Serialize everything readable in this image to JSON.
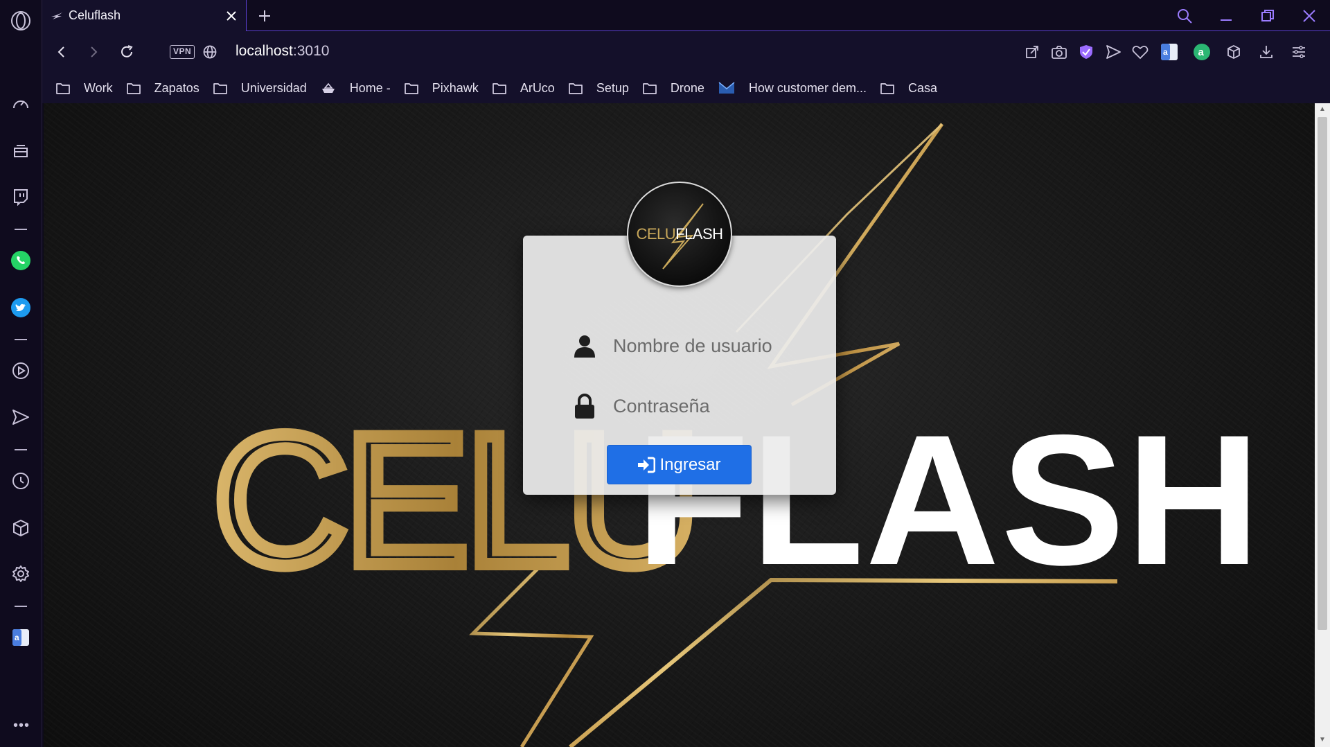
{
  "browser": {
    "tab": {
      "title": "Celuflash"
    },
    "url": {
      "host": "localhost",
      "port": ":3010"
    },
    "vpn_label": "VPN",
    "bookmarks": [
      {
        "label": "Work",
        "icon": "folder-icon"
      },
      {
        "label": "Zapatos",
        "icon": "folder-icon"
      },
      {
        "label": "Universidad",
        "icon": "folder-icon"
      },
      {
        "label": "Home -",
        "icon": "boat-icon"
      },
      {
        "label": "Pixhawk",
        "icon": "folder-icon"
      },
      {
        "label": "ArUco",
        "icon": "folder-icon"
      },
      {
        "label": "Setup",
        "icon": "folder-icon"
      },
      {
        "label": "Drone",
        "icon": "folder-icon"
      },
      {
        "label": "How customer dem...",
        "icon": "envelope-icon"
      },
      {
        "label": "Casa",
        "icon": "folder-icon"
      }
    ],
    "sidebar_more": "•••"
  },
  "page": {
    "background_logo": {
      "part1": "CELU",
      "part2": "FLASH"
    },
    "logo": {
      "part1": "CELU",
      "part2": "FLASH"
    },
    "login": {
      "username_placeholder": "Nombre de usuario",
      "password_placeholder": "Contraseña",
      "submit_label": "Ingresar"
    }
  },
  "colors": {
    "accent_purple": "#5a3fd0",
    "button_blue": "#1f6fe6",
    "gold": "#c9a85a"
  }
}
